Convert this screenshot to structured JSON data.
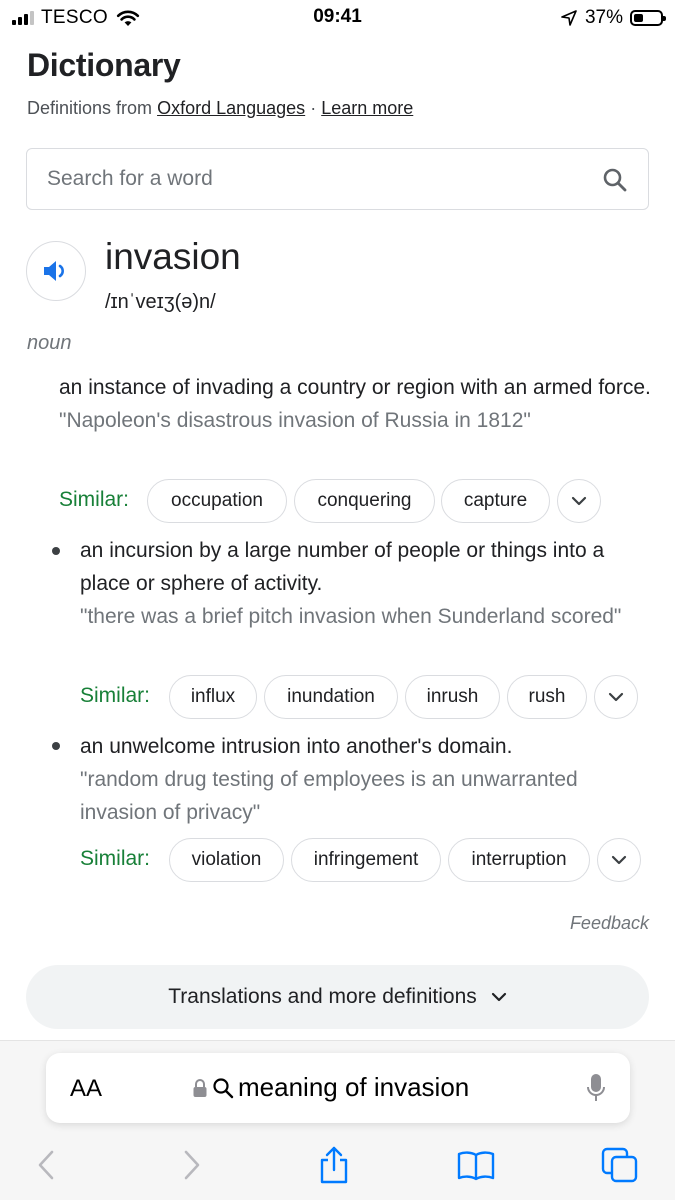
{
  "status_bar": {
    "carrier": "TESCO",
    "time": "09:41",
    "battery_percent": "37%",
    "battery_level": 0.37,
    "icons": [
      "cellular-signal-icon",
      "wifi-icon",
      "location-arrow-icon",
      "battery-icon"
    ]
  },
  "header": {
    "title": "Dictionary",
    "source_prefix": "Definitions from",
    "source_link": "Oxford Languages",
    "separator": "·",
    "learn_more": "Learn more"
  },
  "search": {
    "placeholder": "Search for a word",
    "value": "",
    "icon": "search-icon"
  },
  "entry": {
    "word": "invasion",
    "phonetic": "/ɪnˈveɪʒ(ə)n/",
    "part_of_speech": "noun",
    "speaker_icon": "speaker-icon",
    "senses": [
      {
        "definition": "an instance of invading a country or region with an armed force.",
        "example": "\"Napoleon's disastrous invasion of Russia in 1812\"",
        "similar_label": "Similar:",
        "similar": [
          "occupation",
          "conquering",
          "capture"
        ]
      },
      {
        "definition": "an incursion by a large number of people or things into a place or sphere of activity.",
        "example": "\"there was a brief pitch invasion when Sunderland scored\"",
        "similar_label": "Similar:",
        "similar": [
          "influx",
          "inundation",
          "inrush",
          "rush"
        ]
      },
      {
        "definition": "an unwelcome intrusion into another's domain.",
        "example": "\"random drug testing of employees is an unwarranted invasion of privacy\"",
        "similar_label": "Similar:",
        "similar": [
          "violation",
          "infringement",
          "interruption"
        ]
      }
    ]
  },
  "feedback": "Feedback",
  "more_button": "Translations and more definitions",
  "safari": {
    "text_size": "AA",
    "url": "meaning of invasion",
    "icons": [
      "lock-icon",
      "search-icon",
      "microphone-icon",
      "back-icon",
      "forward-icon",
      "share-icon",
      "bookmarks-icon",
      "tabs-icon"
    ]
  },
  "colors": {
    "similar_label": "#188038",
    "speaker": "#1a73e8",
    "safari_blue": "#007aff",
    "muted": "#70757a"
  }
}
